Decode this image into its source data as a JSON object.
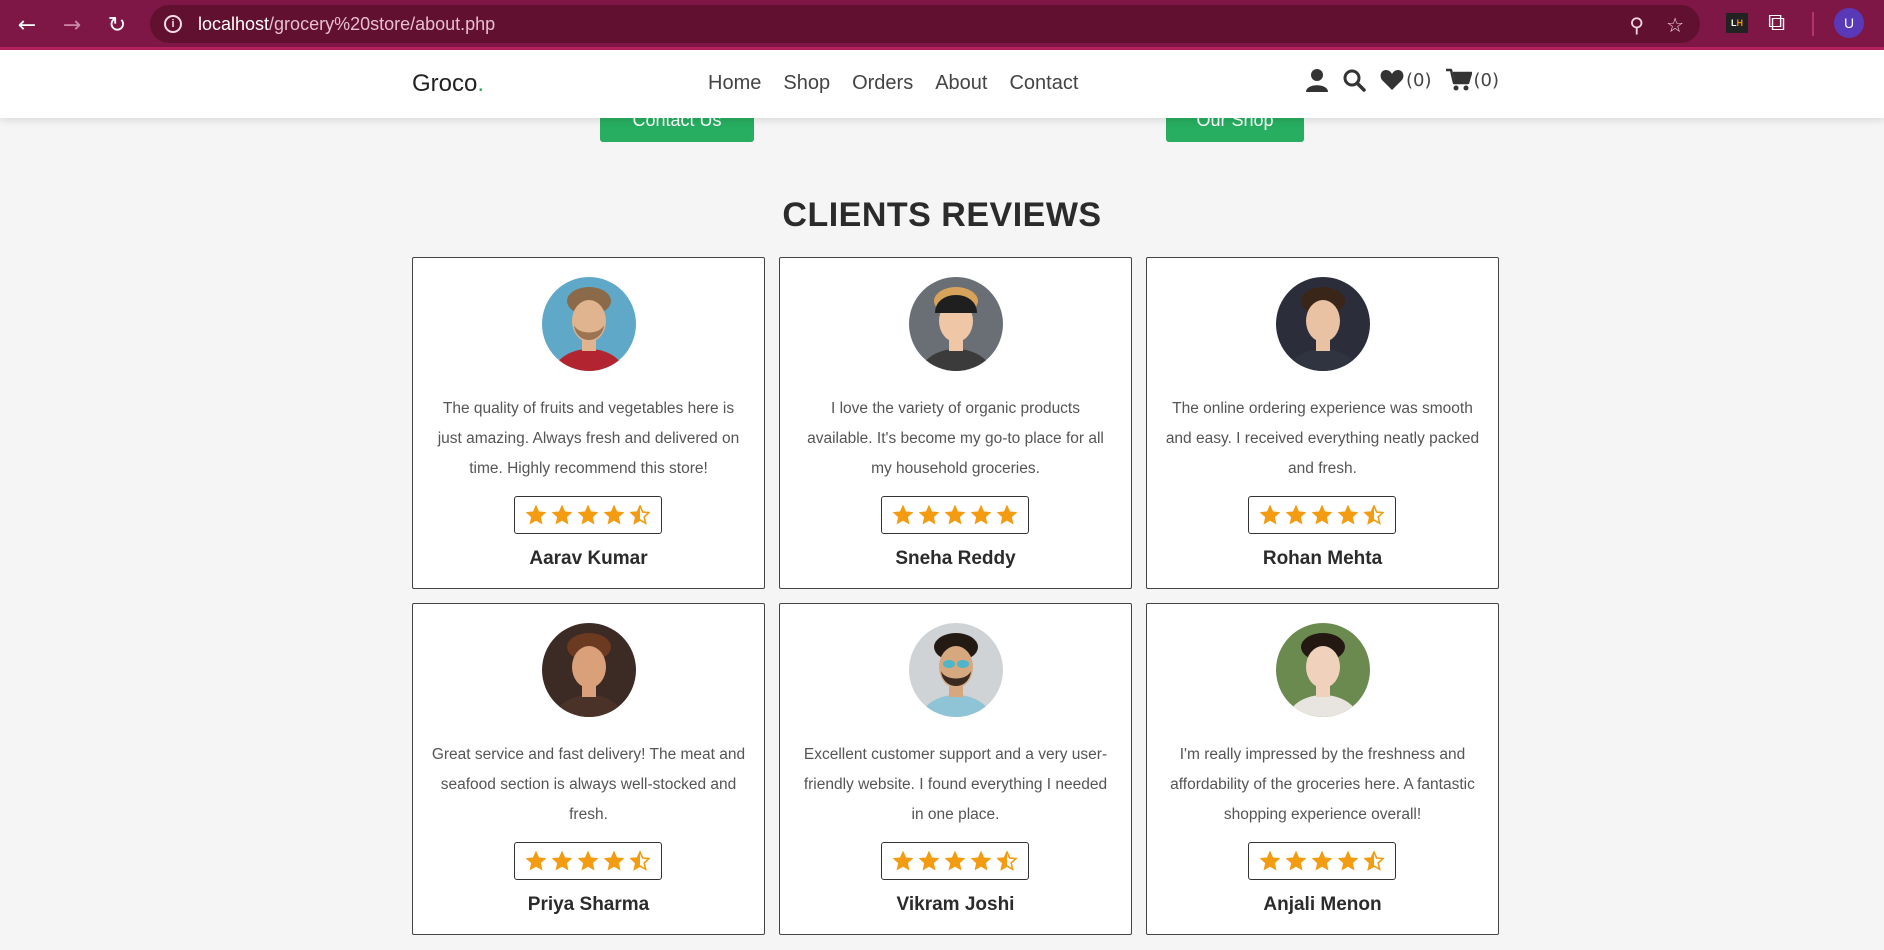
{
  "browser": {
    "url_host": "localhost",
    "url_path": "/grocery%20store/about.php",
    "profile_initial": "U",
    "extension_label_l": "L",
    "extension_label_h": "H"
  },
  "header": {
    "logo_text": "Groco",
    "logo_dot": ".",
    "nav": [
      "Home",
      "Shop",
      "Orders",
      "About",
      "Contact"
    ],
    "wishlist_count": "(0)",
    "cart_count": "(0)"
  },
  "top_buttons": {
    "contact_label": "Contact Us",
    "shop_label": "Our Shop"
  },
  "reviews": {
    "title": "CLIENTS REVIEWS",
    "items": [
      {
        "name": "Aarav Kumar",
        "text": "The quality of fruits and vegetables here is just amazing. Always fresh and delivered on time. Highly recommend this store!",
        "rating": 4.5
      },
      {
        "name": "Sneha Reddy",
        "text": "I love the variety of organic products available. It's become my go-to place for all my household groceries.",
        "rating": 5
      },
      {
        "name": "Rohan Mehta",
        "text": "The online ordering experience was smooth and easy. I received everything neatly packed and fresh.",
        "rating": 4.5
      },
      {
        "name": "Priya Sharma",
        "text": "Great service and fast delivery! The meat and seafood section is always well-stocked and fresh.",
        "rating": 4.5
      },
      {
        "name": "Vikram Joshi",
        "text": "Excellent customer support and a very user-friendly website. I found everything I needed in one place.",
        "rating": 4.5
      },
      {
        "name": "Anjali Menon",
        "text": "I'm really impressed by the freshness and affordability of the groceries here. A fantastic shopping experience overall!",
        "rating": 4.5
      }
    ]
  },
  "colors": {
    "chrome": "#7e1646",
    "accent_green": "#27ae60",
    "star": "#f39c12"
  }
}
